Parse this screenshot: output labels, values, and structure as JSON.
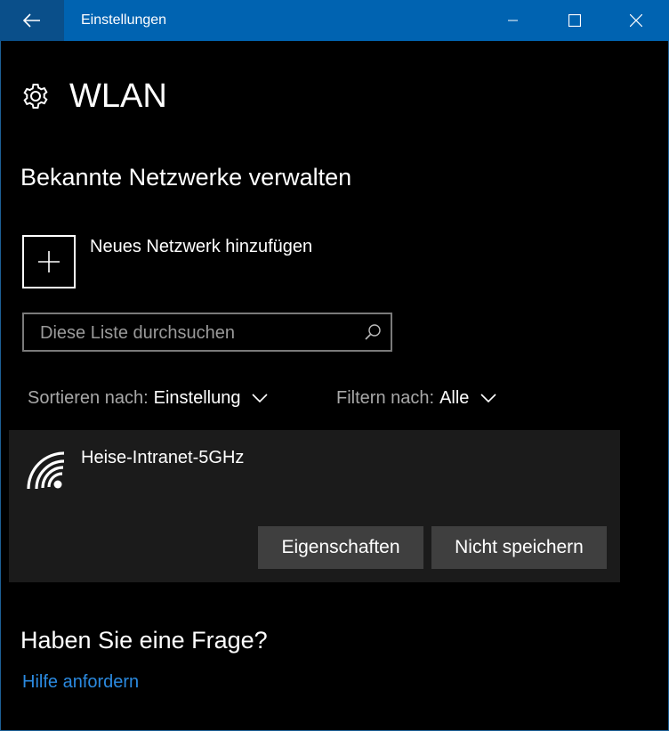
{
  "window": {
    "title": "Einstellungen"
  },
  "page": {
    "title": "WLAN",
    "icon": "gear-icon"
  },
  "manage": {
    "section_title": "Bekannte Netzwerke verwalten",
    "add_network_label": "Neues Netzwerk hinzufügen",
    "search_placeholder": "Diese Liste durchsuchen",
    "search_value": "",
    "sort": {
      "label": "Sortieren nach:",
      "value": "Einstellung"
    },
    "filter": {
      "label": "Filtern nach:",
      "value": "Alle"
    }
  },
  "networks": [
    {
      "name": "Heise-Intranet-5GHz",
      "icon": "wifi-signal-icon",
      "properties_label": "Eigenschaften",
      "forget_label": "Nicht speichern"
    }
  ],
  "help": {
    "title": "Haben Sie eine Frage?",
    "link": "Hilfe anfordern"
  },
  "colors": {
    "titlebar": "#0063b1",
    "background": "#000000",
    "card": "#1b1b1b",
    "button": "#3f3f3f",
    "link": "#2b8ae0"
  }
}
